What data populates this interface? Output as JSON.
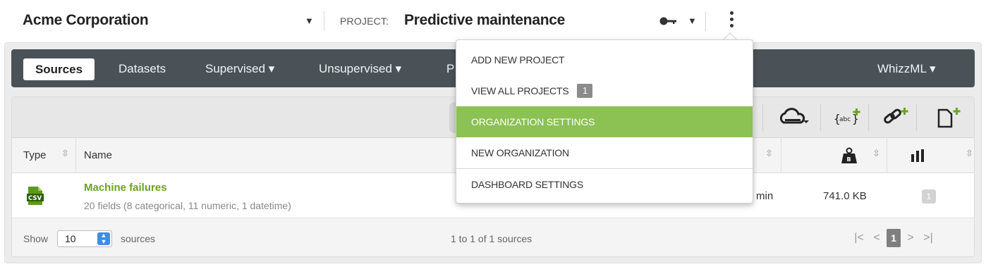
{
  "topbar": {
    "org_name": "Acme Corporation",
    "project_label": "PROJECT:",
    "project_name": "Predictive maintenance"
  },
  "nav": {
    "items": [
      {
        "label": "Sources",
        "active": true
      },
      {
        "label": "Datasets"
      },
      {
        "label": "Supervised ▾"
      },
      {
        "label": "Unsupervised ▾"
      },
      {
        "label": "P"
      },
      {
        "label": "WhizzML ▾"
      }
    ]
  },
  "menu": {
    "items": [
      {
        "label": "ADD NEW PROJECT"
      },
      {
        "label": "VIEW ALL PROJECTS",
        "badge": "1"
      },
      {
        "label": "ORGANIZATION SETTINGS",
        "active": true
      },
      {
        "label": "NEW ORGANIZATION"
      },
      {
        "label": "DASHBOARD SETTINGS"
      }
    ]
  },
  "table": {
    "headers": {
      "type": "Type",
      "name": "Name"
    },
    "rows": [
      {
        "name": "Machine failures",
        "fields": "20 fields (8 categorical, 11 numeric, 1 datetime)",
        "age": "min",
        "size": "741.0 KB",
        "count": "1",
        "type_icon": "csv-file-icon"
      }
    ]
  },
  "footer": {
    "show_label": "Show",
    "page_size": "10",
    "sources_label": "sources",
    "pager_info": "1 to 1 of 1 sources",
    "current_page": "1"
  },
  "colors": {
    "accent_green": "#8cc153",
    "link_green": "#6aa31d",
    "navbar": "#4a5258",
    "spinner_blue": "#3c8ee6"
  }
}
